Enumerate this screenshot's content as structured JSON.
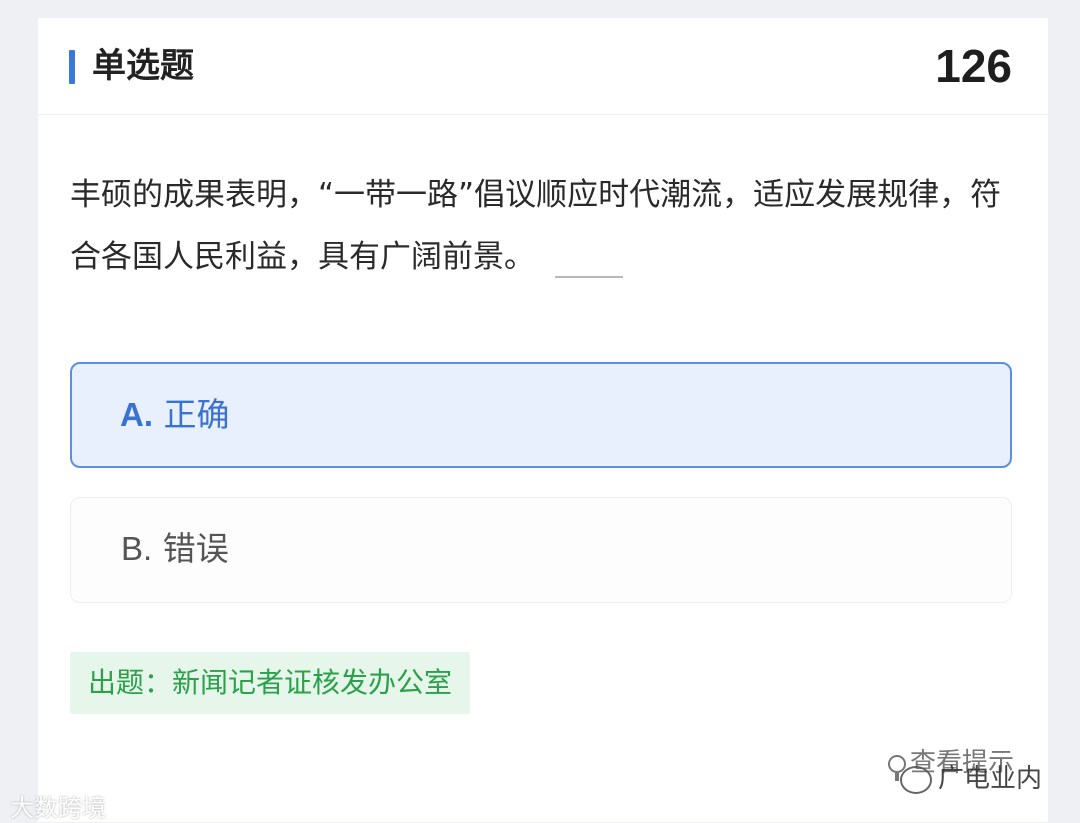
{
  "question": {
    "type_label": "单选题",
    "number": "126",
    "stem": "丰硕的成果表明，“一带一路”倡议顺应时代潮流，适应发展规律，符合各国人民利益，具有广阔前景。"
  },
  "options": [
    {
      "letter": "A.",
      "text": "正确",
      "state": "selected"
    },
    {
      "letter": "B.",
      "text": "错误",
      "state": "unselected"
    }
  ],
  "source_label": "出题：新闻记者证核发办公室",
  "hint_label": "查看提示",
  "watermarks": {
    "left": "大数跨境",
    "right": "广电业内"
  },
  "colors": {
    "accent": "#3a78d8",
    "selected_bg": "#e9f0fd",
    "source_green": "#2aa14a",
    "source_bg": "#e6f6ea"
  }
}
